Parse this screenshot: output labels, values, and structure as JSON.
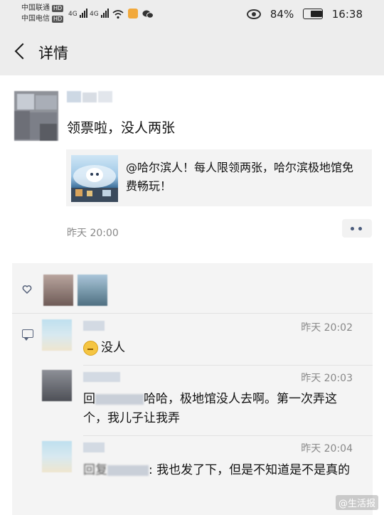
{
  "status_bar": {
    "carrier1": "中国联通",
    "carrier2": "中国电信",
    "hd_badge": "HD",
    "network": "4G",
    "battery": "84%",
    "battery_level": 0.84,
    "time": "16:38"
  },
  "nav": {
    "title": "详情"
  },
  "post": {
    "text": "领票啦，没人两张",
    "share_text": "@哈尔滨人！每人限领两张，哈尔滨极地馆免费畅玩！",
    "time": "昨天 20:00"
  },
  "comments": [
    {
      "time": "昨天 20:02",
      "text": "没人"
    },
    {
      "time": "昨天 20:03",
      "prefix": "回",
      "text": "哈哈，极地馆没人去啊。第一次弄这个，我儿子让我弄"
    },
    {
      "time": "昨天 20:04",
      "prefix": "回复",
      "text": ": 我也发了下，但是不知道是不是真的"
    }
  ],
  "watermark": "@生活报",
  "colors": {
    "bar_bg": "#ededed",
    "panel_bg": "#f4f4f4",
    "link_blue": "#4a5b7c"
  }
}
